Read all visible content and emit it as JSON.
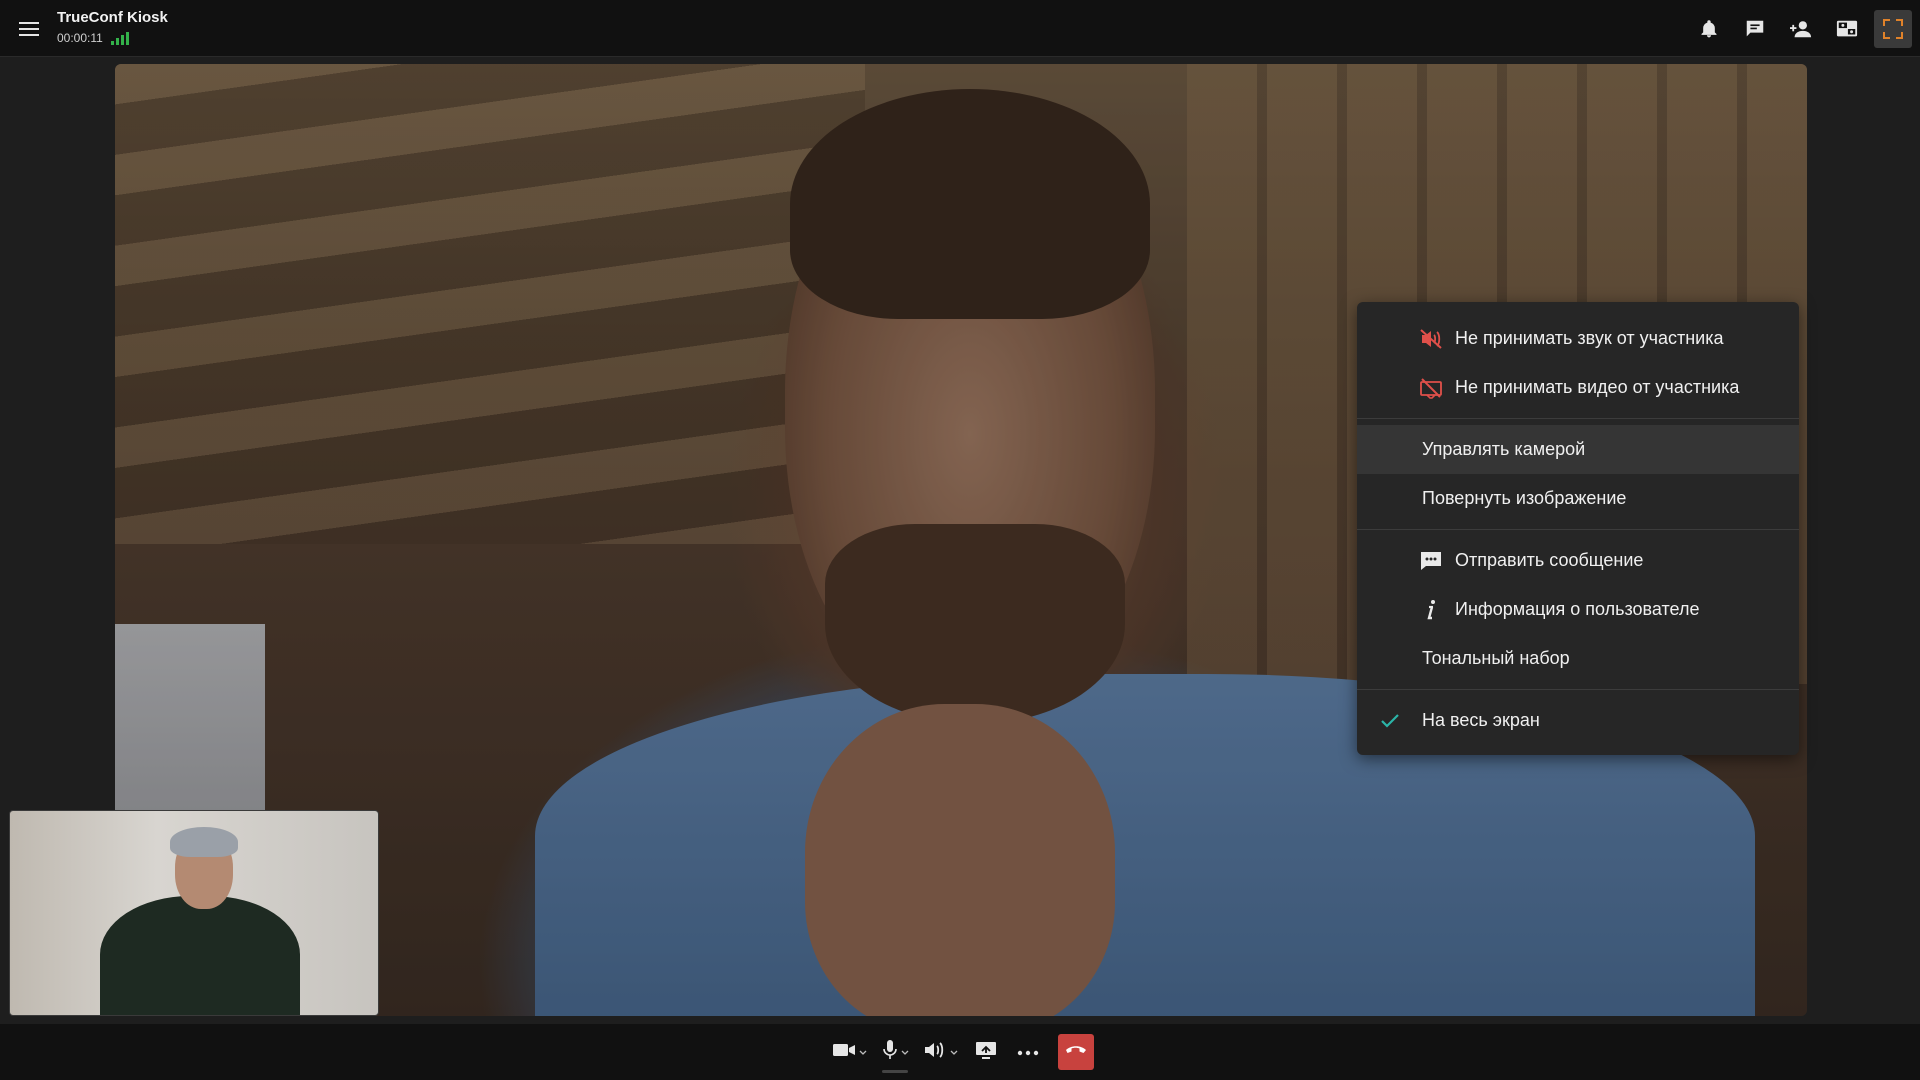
{
  "header": {
    "app_title": "TrueConf Kiosk",
    "call_timer": "00:00:11",
    "signal_bars": 4,
    "icons": [
      "menu-icon",
      "bell-icon",
      "chat-icon",
      "add-participant-icon",
      "layout-icon",
      "fullscreen-icon"
    ]
  },
  "context_menu": {
    "items": [
      {
        "label": "Не принимать звук от участника",
        "icon": "speaker-muted-icon"
      },
      {
        "label": "Не принимать видео от участника",
        "icon": "video-off-icon"
      },
      {
        "label": "Управлять камерой"
      },
      {
        "label": "Повернуть изображение"
      },
      {
        "label": "Отправить сообщение",
        "icon": "message-icon"
      },
      {
        "label": "Информация о пользователе",
        "icon": "info-icon"
      },
      {
        "label": "Тональный набор"
      },
      {
        "label": "На весь экран",
        "checked": true
      }
    ]
  },
  "toolbar": {
    "icons": [
      "camera-icon",
      "microphone-icon",
      "speaker-icon",
      "screen-share-icon",
      "more-icon",
      "hangup-icon"
    ]
  },
  "colors": {
    "accent_orange": "#e0822a",
    "signal_green": "#33b24a",
    "muted_red": "#e0504a",
    "check_teal": "#2bb5a8",
    "hangup_red": "#c8423e"
  }
}
